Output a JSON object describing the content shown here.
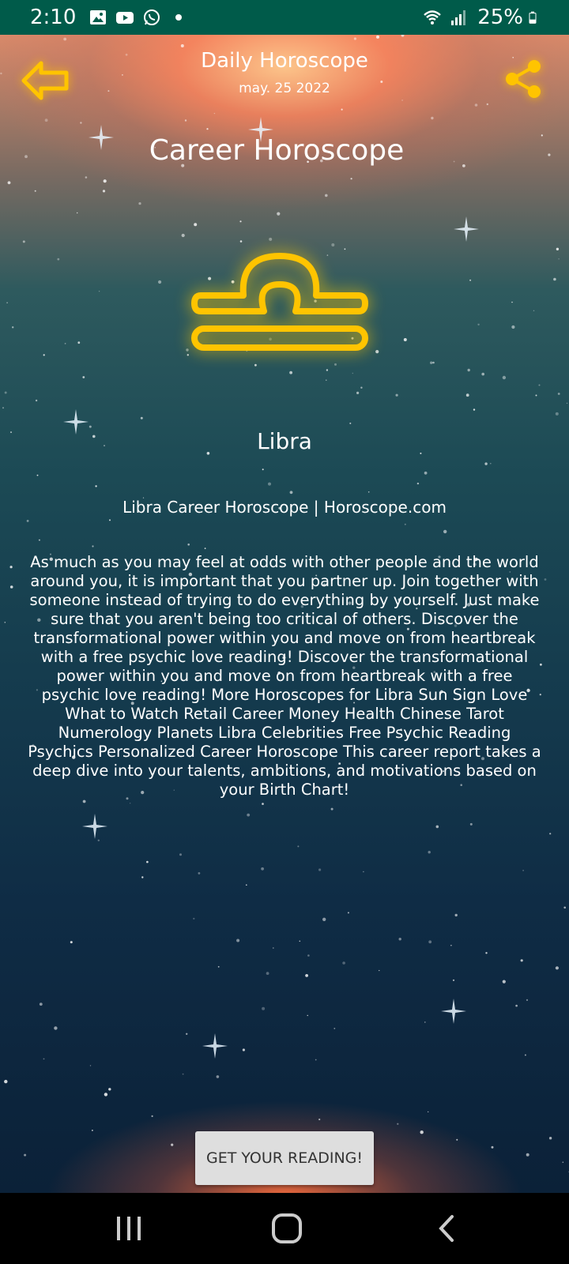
{
  "status_bar": {
    "time": "2:10",
    "battery": "25%",
    "icons": [
      "image-icon",
      "youtube-icon",
      "whatsapp-icon",
      "dot-icon",
      "wifi-icon",
      "signal-icon",
      "battery-icon"
    ]
  },
  "header": {
    "title": "Daily Horoscope",
    "date": "may. 25 2022",
    "back_icon": "back-arrow-icon",
    "share_icon": "share-icon"
  },
  "main": {
    "page_title": "Career Horoscope",
    "sign_icon": "libra-icon",
    "sign_name": "Libra",
    "source": "Libra Career Horoscope | Horoscope.com",
    "text": "As much as you may feel at odds with other people and the world around you, it is important that you partner up. Join together with someone instead of trying to do everything by yourself. Just make sure that you aren't being too critical of others. Discover the transformational power within you and move on from heartbreak with a free psychic love reading! Discover the transformational power within you and move on from heartbreak with a free psychic love reading! More Horoscopes for Libra Sun Sign Love What to Watch Retail Career Money Health Chinese Tarot Numerology Planets Libra Celebrities Free Psychic Reading Psychics Personalized Career Horoscope This career report takes a deep dive into your talents, ambitions, and motivations based on your Birth Chart!",
    "button_label": "GET YOUR READING!"
  },
  "nav_bar": {
    "icons": [
      "recent-apps-icon",
      "home-icon",
      "back-icon"
    ]
  },
  "colors": {
    "status_bar": "#005b4a",
    "accent_gold": "#ffc400",
    "button_bg": "#dedede"
  }
}
